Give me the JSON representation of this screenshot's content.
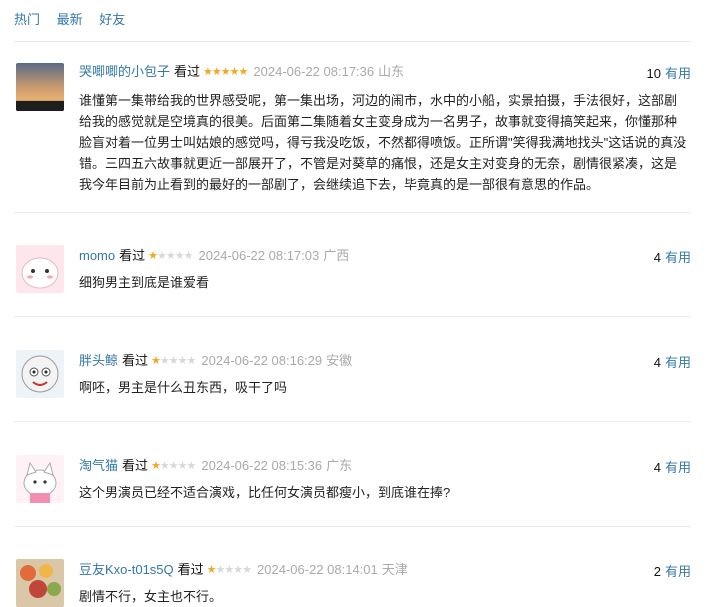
{
  "tabs": [
    "热门",
    "最新",
    "好友"
  ],
  "comments": [
    {
      "user": "哭唧唧的小包子",
      "kind": "看过",
      "rating": 5,
      "time": "2024-06-22 08:17:36",
      "location": "山东",
      "useful_count": "10",
      "useful_label": "有用",
      "text": "谁懂第一集带给我的世界感受呢，第一集出场，河边的闹市，水中的小船，实景拍摄，手法很好，这部剧给我的感觉就是空境真的很美。后面第二集随着女主变身成为一名男子，故事就变得搞笑起来，你懂那种脸盲对着一位男士叫姑娘的感觉吗，得亏我没吃饭，不然都得喷饭。正所谓\"笑得我满地找头\"这话说的真没错。三四五六故事就更近一部展开了，不管是对葵草的痛恨，还是女主对变身的无奈，剧情很紧凑，这是我今年目前为止看到的最好的一部剧了，会继续追下去，毕竟真的是一部很有意思的作品。"
    },
    {
      "user": "momo",
      "kind": "看过",
      "rating": 1,
      "time": "2024-06-22 08:17:03",
      "location": "广西",
      "useful_count": "4",
      "useful_label": "有用",
      "text": "细狗男主到底是谁爱看"
    },
    {
      "user": "胖头鲸",
      "kind": "看过",
      "rating": 1,
      "time": "2024-06-22 08:16:29",
      "location": "安徽",
      "useful_count": "4",
      "useful_label": "有用",
      "text": "啊呸，男主是什么丑东西，吸干了吗"
    },
    {
      "user": "淘气猫",
      "kind": "看过",
      "rating": 1,
      "time": "2024-06-22 08:15:36",
      "location": "广东",
      "useful_count": "4",
      "useful_label": "有用",
      "text": "这个男演员已经不适合演戏，比任何女演员都瘦小，到底谁在捧?"
    },
    {
      "user": "豆友Kxo-t01s5Q",
      "kind": "看过",
      "rating": 1,
      "time": "2024-06-22 08:14:01",
      "location": "天津",
      "useful_count": "2",
      "useful_label": "有用",
      "text": "剧情不行，女主也不行。"
    }
  ]
}
